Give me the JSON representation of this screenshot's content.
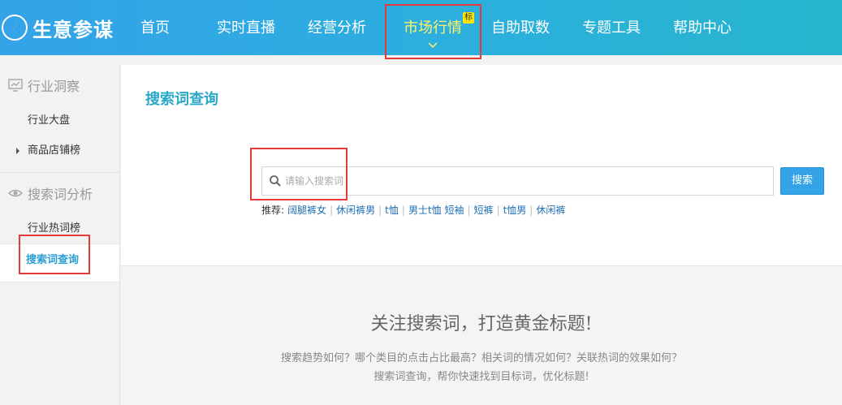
{
  "header": {
    "brand": "生意参谋",
    "nav": [
      {
        "label": "首页"
      },
      {
        "label": "实时直播"
      },
      {
        "label": "经营分析"
      },
      {
        "label": "市场行情",
        "badge": "标",
        "active": true
      },
      {
        "label": "自助取数"
      },
      {
        "label": "专题工具"
      },
      {
        "label": "帮助中心"
      }
    ]
  },
  "sidebar": {
    "groups": [
      {
        "label": "行业洞察",
        "icon": "chart-monitor-icon",
        "items": [
          {
            "label": "行业大盘"
          },
          {
            "label": "商品店铺榜",
            "expandable": true
          }
        ]
      },
      {
        "label": "搜索词分析",
        "icon": "eye-icon",
        "items": [
          {
            "label": "行业热词榜"
          },
          {
            "label": "搜索词查询",
            "active": true
          }
        ]
      }
    ]
  },
  "main": {
    "title": "搜索词查询",
    "search": {
      "placeholder": "请输入搜索词",
      "value": "",
      "button": "搜索"
    },
    "recommend": {
      "label": "推荐:",
      "items": [
        "阔腿裤女",
        "休闲裤男",
        "t恤",
        "男士t恤 短袖",
        "短裤",
        "t恤男",
        "休闲裤"
      ]
    },
    "promo": {
      "title": "关注搜索词，打造黄金标题!",
      "line1": "搜索趋势如何？哪个类目的点击占比最高？相关词的情况如何？关联热词的效果如何？",
      "line2": "搜索词查询，帮你快速找到目标词，优化标题!"
    }
  },
  "colors": {
    "header_start": "#34a3e8",
    "header_end": "#26b5cc",
    "accent": "#2aa8c7",
    "active_nav": "#fff36b",
    "highlight_box": "#e53b3b"
  }
}
